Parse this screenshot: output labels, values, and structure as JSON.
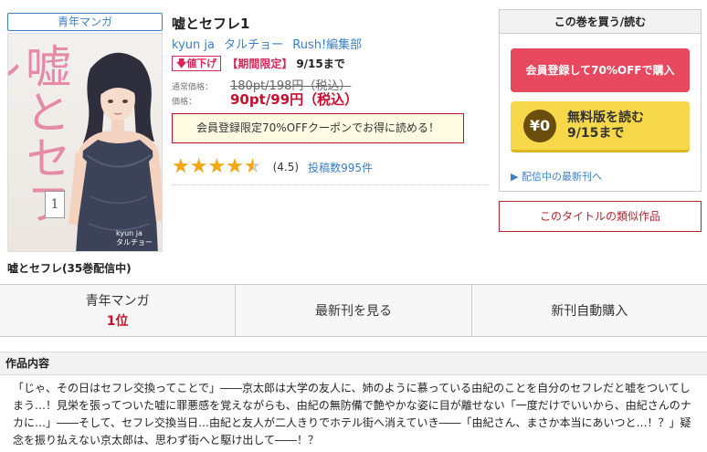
{
  "product": {
    "genre_tag": "青年マンガ",
    "title": "嘘とセフレ1",
    "authors": [
      "kyun ja",
      "タルチョー",
      "Rush!編集部"
    ],
    "series_caption": "嘘とセフレ(35巻配信中)",
    "cover": {
      "title_text": "嘘とセフレ",
      "volume_number": "1",
      "credit_line1": "kyun ja",
      "credit_line2": "タルチョー"
    }
  },
  "sale": {
    "badge": "値下げ",
    "period_label": "【期間限定】",
    "end_date": "9/15まで"
  },
  "price": {
    "regular_label": "通常価格：",
    "regular_value": "180pt/198円（税込）",
    "current_label": "価格：",
    "current_value": "90pt/99円（税込）"
  },
  "coupon": {
    "text": "会員登録限定70%OFFクーポンでお得に読める！"
  },
  "rating": {
    "score": 4.5,
    "score_text": "(4.5)",
    "reviews_text": "投稿数995件",
    "star_glyphs": "★★★★★"
  },
  "purchase_panel": {
    "heading": "この巻を買う/読む",
    "member_button": "会員登録して70%OFFで購入",
    "free_coin": "¥0",
    "free_line1": "無料版を読む",
    "free_line2": "9/15まで",
    "latest_link": "配信中の最新刊へ",
    "similar_button": "このタイトルの類似作品"
  },
  "tabs": [
    {
      "label": "青年マンガ",
      "rank": "1位"
    },
    {
      "label": "最新刊を見る"
    },
    {
      "label": "新刊自動購入"
    }
  ],
  "description": {
    "heading": "作品内容",
    "text": "「じゃ、その日はセフレ交換ってことで」――京太郎は大学の友人に、姉のように慕っている由紀のことを自分のセフレだと嘘をついてしまう…！見栄を張ってついた嘘に罪悪感を覚えながらも、由紀の無防備で艶やかな姿に目が離せない「一度だけでいいから、由紀さんのナカに…」――そして、セフレ交換当日…由紀と友人が二人きりでホテル街へ消えていき――「由紀さん、まさか本当にあいつと…！？」疑念を振り払えない京太郎は、思わず街へと駆け出して――！？"
  },
  "colors": {
    "accent_blue": "#3a7fc7",
    "price_red": "#c8102e",
    "member_button": "#e8485e",
    "free_button": "#f7d84a",
    "star": "#f3a712"
  }
}
